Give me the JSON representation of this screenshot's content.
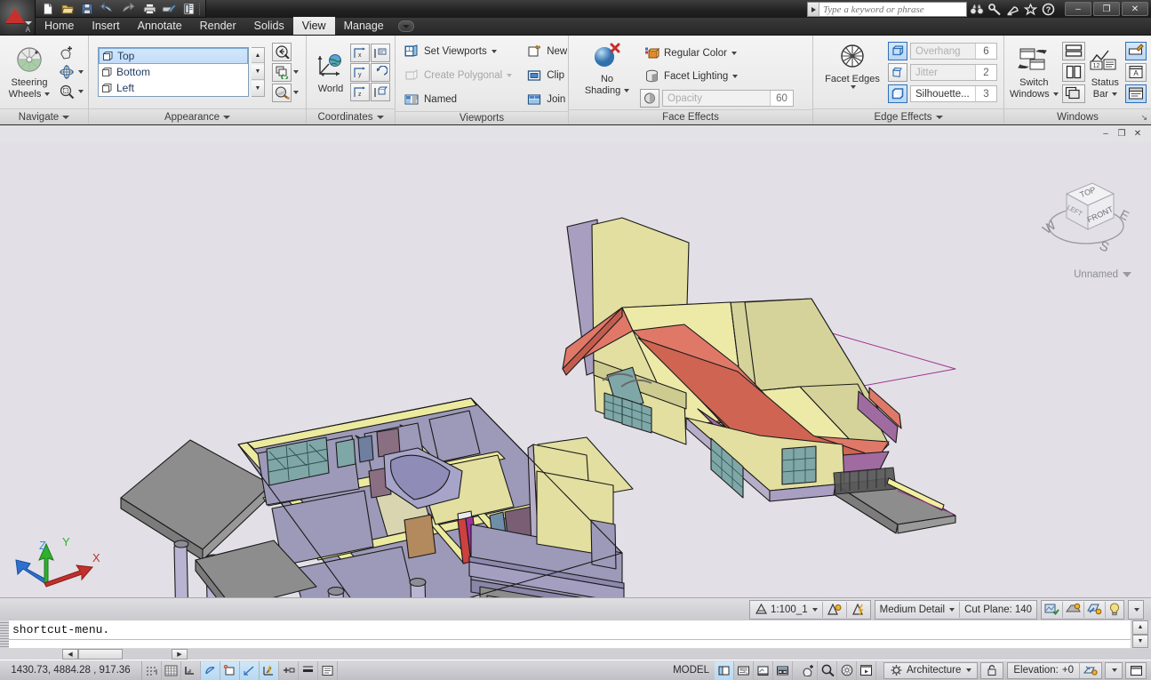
{
  "app": {
    "title_search_placeholder": "Type a keyword or phrase",
    "logo_name": "autocad-logo"
  },
  "quick_access": {
    "items": [
      {
        "name": "new-file-icon",
        "label": "New"
      },
      {
        "name": "open-file-icon",
        "label": "Open"
      },
      {
        "name": "save-icon",
        "label": "Save"
      },
      {
        "name": "undo-icon",
        "label": "Undo"
      },
      {
        "name": "redo-icon",
        "label": "Redo"
      },
      {
        "name": "plot-icon",
        "label": "Plot"
      },
      {
        "name": "plot-preview-icon",
        "label": "Plot Preview"
      },
      {
        "name": "project-navigator-icon",
        "label": "Project Navigator"
      },
      {
        "name": "qat-customize-icon",
        "label": "Customize"
      }
    ]
  },
  "title_icons": [
    {
      "name": "search-binoculars-icon",
      "label": "Search"
    },
    {
      "name": "communication-center-icon",
      "label": "Communication Center"
    },
    {
      "name": "favorites-star-icon",
      "label": "Favorites"
    },
    {
      "name": "help-icon",
      "label": "Help"
    }
  ],
  "window_controls": {
    "minimize": "–",
    "restore": "❐",
    "close": "✕"
  },
  "tabs": [
    {
      "label": "Home",
      "active": false
    },
    {
      "label": "Insert",
      "active": false
    },
    {
      "label": "Annotate",
      "active": false
    },
    {
      "label": "Render",
      "active": false
    },
    {
      "label": "Solids",
      "active": false
    },
    {
      "label": "View",
      "active": true
    },
    {
      "label": "Manage",
      "active": false
    }
  ],
  "ribbon": {
    "panels": [
      {
        "name": "navigate",
        "label": "Navigate",
        "has_caret": true,
        "big_button": {
          "label_line1": "Steering",
          "label_line2": "Wheels",
          "icon": "steering-wheel-icon"
        },
        "small_buttons": [
          {
            "label": "",
            "icon": "pan-icon"
          },
          {
            "label": "",
            "icon": "orbit-icon"
          },
          {
            "label": "",
            "icon": "zoom-extents-icon"
          }
        ]
      },
      {
        "name": "appearance",
        "label": "Appearance",
        "has_caret": true,
        "view_list": [
          {
            "label": "Top",
            "selected": true
          },
          {
            "label": "Bottom",
            "selected": false
          },
          {
            "label": "Left",
            "selected": false
          }
        ],
        "side_buttons": [
          {
            "icon": "back-zoom-icon"
          },
          {
            "icon": "visual-style-manager-icon"
          },
          {
            "icon": "materials-browser-icon"
          }
        ]
      },
      {
        "name": "coordinates",
        "label": "Coordinates",
        "has_caret": true,
        "big_button": {
          "label_line1": "World",
          "label_line2": "",
          "icon": "world-ucs-icon"
        },
        "small_buttons": [
          {
            "icon": "ucs-x-icon"
          },
          {
            "icon": "ucs-face-icon"
          },
          {
            "icon": "ucs-y-icon"
          },
          {
            "icon": "ucs-previous-icon"
          },
          {
            "icon": "ucs-z-icon"
          },
          {
            "icon": "ucs-object-icon"
          }
        ]
      },
      {
        "name": "viewports",
        "label": "Viewports",
        "has_caret": false,
        "items": [
          {
            "label": "Set Viewports",
            "icon": "set-viewports-icon",
            "dropdown": true,
            "disabled": false
          },
          {
            "label": "Create Polygonal",
            "icon": "create-polygonal-icon",
            "dropdown": true,
            "disabled": true
          },
          {
            "label": "Named",
            "icon": "named-viewports-icon",
            "dropdown": false,
            "disabled": false
          },
          {
            "label": "New",
            "icon": "new-viewport-icon",
            "dropdown": false,
            "disabled": false
          },
          {
            "label": "Clip",
            "icon": "clip-viewport-icon",
            "dropdown": false,
            "disabled": false
          },
          {
            "label": "Join",
            "icon": "join-viewport-icon",
            "dropdown": false,
            "disabled": false
          }
        ]
      },
      {
        "name": "face-effects",
        "label": "Face Effects",
        "has_caret": false,
        "big_button": {
          "label_line1": "No",
          "label_line2": "Shading",
          "icon": "no-shading-icon"
        },
        "items": [
          {
            "label": "Regular Color",
            "icon": "regular-color-icon",
            "dropdown": true
          },
          {
            "label": "Facet Lighting",
            "icon": "facet-lighting-icon",
            "dropdown": true
          }
        ],
        "opacity": {
          "toggle_icon": "opacity-toggle-icon",
          "label": "Opacity",
          "value": "60"
        }
      },
      {
        "name": "edge-effects",
        "label": "Edge Effects",
        "has_caret": true,
        "big_button": {
          "label_line1": "Facet Edges",
          "label_line2": "",
          "icon": "facet-edges-icon"
        },
        "fields": [
          {
            "toggle_icon": "overhang-toggle-icon",
            "label": "Overhang",
            "value": "6",
            "active": false
          },
          {
            "toggle_icon": "jitter-toggle-icon",
            "label": "Jitter",
            "value": "2",
            "active": false
          },
          {
            "toggle_icon": "silhouette-toggle-icon",
            "label": "Silhouette...",
            "value": "3",
            "active": true
          }
        ]
      },
      {
        "name": "windows",
        "label": "Windows",
        "has_caret": false,
        "has_diag": true,
        "big_button": {
          "label_line1": "Switch",
          "label_line2": "Windows",
          "icon": "switch-windows-icon"
        },
        "tile_buttons": [
          {
            "icon": "tile-horizontal-icon"
          },
          {
            "icon": "tile-vertical-icon"
          },
          {
            "icon": "cascade-icon"
          }
        ],
        "status_bar_button": {
          "label_line1": "Status",
          "label_line2": "Bar",
          "icon": "status-bar-icon"
        },
        "toggle_buttons": [
          {
            "icon": "clean-screen-icon",
            "selected": true
          },
          {
            "icon": "text-window-icon",
            "selected": false
          },
          {
            "icon": "properties-palette-icon",
            "selected": true
          }
        ]
      }
    ]
  },
  "document_window_controls": {
    "minimize": "–",
    "restore": "❐",
    "close": "✕"
  },
  "viewport": {
    "viewcube": {
      "top_face": "TOP",
      "front_face": "FRONT",
      "left_face": "LEFT",
      "compass": {
        "west": "W",
        "east": "E",
        "south": "S"
      }
    },
    "view_name": "Unnamed",
    "ucs_icon": {
      "x": "X",
      "y": "Y",
      "z": "Z"
    },
    "background_color": "#e2e0e6"
  },
  "model_colors": {
    "floor": "#9d99b8",
    "wall_yellow": "#eae89c",
    "roof_khaki": "#d4d29a",
    "roof_light": "#eeeaa6",
    "fascia_red": "#e07868",
    "fascia_purple": "#a06ba0",
    "window_teal": "#7fa7a7",
    "slab_gray": "#8d8d8d",
    "magenta": "#b0338c",
    "brown_door": "#b38a5e"
  },
  "scale_bar": {
    "annotation_scale": "1:100_1",
    "annotation_visibility_icon": "annotation-visibility-icon",
    "auto_scale_icon": "auto-add-scale-icon",
    "detail_level": "Medium Detail",
    "cut_plane_label": "Cut Plane:",
    "cut_plane_value": "140",
    "right_icons": [
      {
        "name": "surface-hatch-icon"
      },
      {
        "name": "shadow-display-icon"
      },
      {
        "name": "layer-key-icon"
      },
      {
        "name": "lights-icon"
      },
      {
        "name": "scalebar-overflow-icon"
      }
    ]
  },
  "command_line": {
    "text": "shortcut-menu.",
    "scroll_up": "▲",
    "scroll_down": "▼",
    "h_left": "◀",
    "h_right": "▶"
  },
  "status_bar": {
    "coordinates": "1430.73,   4884.28 , 917.36",
    "draft_toggles": [
      {
        "name": "snap-mode-toggle",
        "on": false
      },
      {
        "name": "grid-display-toggle",
        "on": false
      },
      {
        "name": "ortho-mode-toggle",
        "on": false
      },
      {
        "name": "polar-tracking-toggle",
        "on": true
      },
      {
        "name": "object-snap-toggle",
        "on": true
      },
      {
        "name": "osnap-tracking-toggle",
        "on": true
      },
      {
        "name": "dynamic-ucs-toggle",
        "on": true
      },
      {
        "name": "dynamic-input-toggle",
        "on": false
      },
      {
        "name": "lineweight-toggle",
        "on": false
      },
      {
        "name": "quick-properties-toggle",
        "on": false
      }
    ],
    "model_label": "MODEL",
    "layout_toggles": [
      {
        "name": "model-space-toggle",
        "on": true
      },
      {
        "name": "quick-view-layouts-icon",
        "on": false
      },
      {
        "name": "quick-view-drawings-icon",
        "on": false
      },
      {
        "name": "annotation-scale-icon",
        "on": false
      }
    ],
    "nav_icons": [
      {
        "name": "pan-status-icon"
      },
      {
        "name": "zoom-status-icon"
      },
      {
        "name": "steering-wheel-status-icon"
      },
      {
        "name": "showmotion-icon"
      }
    ],
    "workspace_label": "Architecture",
    "workspace_icon": "workspace-gear-icon",
    "lock_icon": "toolbar-lock-icon",
    "elevation_label": "Elevation:",
    "elevation_value": "+0",
    "replace_z_icon": "replace-z-icon",
    "overflow_caret": "▼",
    "clean_screen_icon": "clean-screen-status-icon"
  }
}
